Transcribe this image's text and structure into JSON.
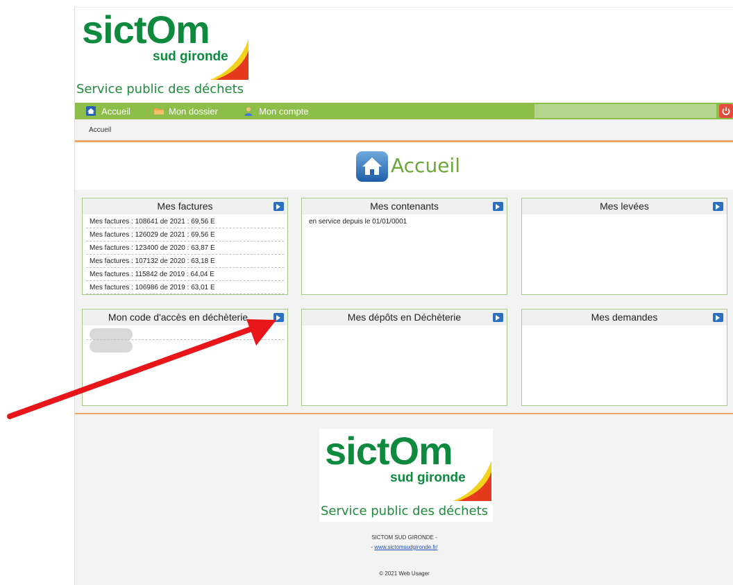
{
  "brand": {
    "logo_main": "sictOm",
    "logo_sub": "sud gironde",
    "tagline": "Service public des déchets"
  },
  "nav": {
    "items": [
      {
        "label": "Accueil",
        "icon": "home-icon"
      },
      {
        "label": "Mon dossier",
        "icon": "folder-icon"
      },
      {
        "label": "Mon compte",
        "icon": "user-icon"
      }
    ],
    "logout_icon": "power-icon"
  },
  "breadcrumb": "Accueil",
  "page_title": "Accueil",
  "panels": {
    "factures": {
      "title": "Mes factures",
      "rows": [
        "Mes factures : 108641 de 2021 : 69,56 E",
        "Mes factures : 126029 de 2021 : 69,56 E",
        "Mes factures : 123400 de 2020 : 63,87 E",
        "Mes factures : 107132 de 2020 : 63,18 E",
        "Mes factures : 115842 de 2019 : 64,04 E",
        "Mes factures : 106986 de 2019 : 63,01 E"
      ]
    },
    "contenants": {
      "title": "Mes contenants",
      "rows": [
        "en service depuis le 01/01/0001"
      ]
    },
    "levees": {
      "title": "Mes levées"
    },
    "code_acces": {
      "title": "Mon code d'accès en déchèterie"
    },
    "depots": {
      "title": "Mes dépôts en Déchèterie"
    },
    "demandes": {
      "title": "Mes demandes"
    }
  },
  "footer": {
    "org": "SICTOM SUD GIRONDE -",
    "link_prefix": "- ",
    "link": "www.sictomsudgironde.fr/",
    "copyright": "© 2021 Web Usager"
  },
  "colors": {
    "brand_green": "#0e8a3e",
    "nav_green": "#8dbe4a",
    "accent_orange": "#f0a56a",
    "panel_button_blue": "#2a6fc0",
    "arrow_red": "#e8161b"
  }
}
